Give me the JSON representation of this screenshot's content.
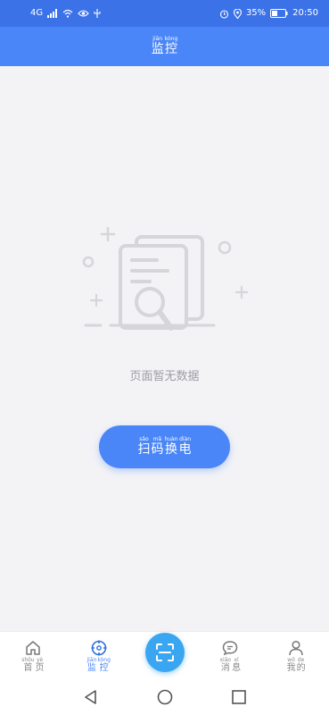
{
  "status_bar": {
    "network": "4G",
    "battery": "35%",
    "time": "20:50"
  },
  "header": {
    "title_ruby": [
      {
        "char": "监",
        "pinyin": "jiān"
      },
      {
        "char": "控",
        "pinyin": "kòng"
      }
    ]
  },
  "empty_state": {
    "text": "页面暂无数据"
  },
  "scan_button": {
    "ruby": [
      {
        "char": "扫",
        "pinyin": "sǎo"
      },
      {
        "char": "码",
        "pinyin": "mǎ"
      },
      {
        "char": "换",
        "pinyin": "huàn"
      },
      {
        "char": "电",
        "pinyin": "diàn"
      }
    ]
  },
  "tabs": [
    {
      "icon": "home-icon",
      "active": false,
      "ruby": [
        {
          "char": "首",
          "pinyin": "shǒu"
        },
        {
          "char": "页",
          "pinyin": "yè"
        }
      ]
    },
    {
      "icon": "monitor-icon",
      "active": true,
      "ruby": [
        {
          "char": "监",
          "pinyin": "jiān"
        },
        {
          "char": "控",
          "pinyin": "kòng"
        }
      ]
    },
    {
      "icon": "message-icon",
      "active": false,
      "ruby": [
        {
          "char": "消",
          "pinyin": "xiāo"
        },
        {
          "char": "息",
          "pinyin": "xī"
        }
      ]
    },
    {
      "icon": "user-icon",
      "active": false,
      "ruby": [
        {
          "char": "我",
          "pinyin": "wǒ"
        },
        {
          "char": "的",
          "pinyin": "de"
        }
      ]
    }
  ],
  "colors": {
    "primary": "#4a86f7",
    "status_bar": "#3c72e8",
    "fab": "#3aa6f2",
    "muted_text": "#9c9ca4"
  }
}
